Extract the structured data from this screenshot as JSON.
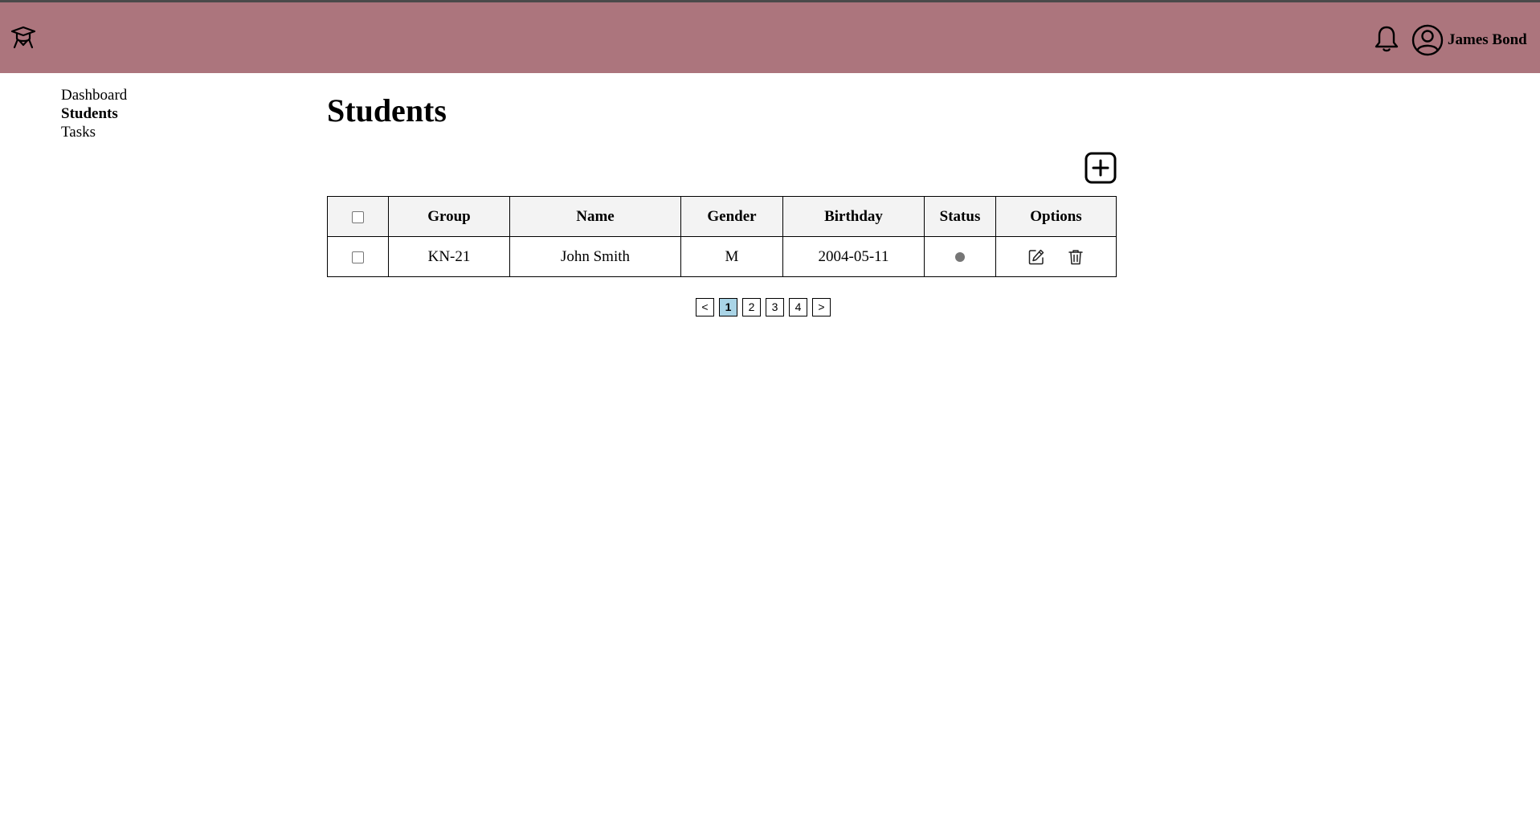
{
  "header": {
    "user_name": "James Bond",
    "background_color": "#ac757d"
  },
  "sidebar": {
    "items": [
      {
        "label": "Dashboard"
      },
      {
        "label": "Students"
      },
      {
        "label": "Tasks"
      }
    ]
  },
  "main": {
    "title": "Students",
    "table": {
      "columns": [
        "Group",
        "Name",
        "Gender",
        "Birthday",
        "Status",
        "Options"
      ],
      "rows": [
        {
          "group": "KN-21",
          "name": "John Smith",
          "gender": "M",
          "birthday": "2004-05-11",
          "status": "inactive"
        }
      ]
    },
    "pagination": {
      "prev": "<",
      "pages": [
        "1",
        "2",
        "3",
        "4"
      ],
      "next": ">",
      "current": "1"
    }
  },
  "colors": {
    "header": "#ac757d",
    "table_header": "#f3f3f3",
    "status_dot": "#767676",
    "active_page": "#a9d4e6"
  },
  "icons": {
    "logo": "graduation-cap-icon",
    "notifications": "bell-icon",
    "user": "user-circle-icon",
    "add": "plus-square-icon",
    "edit": "edit-icon",
    "delete": "trash-icon"
  }
}
